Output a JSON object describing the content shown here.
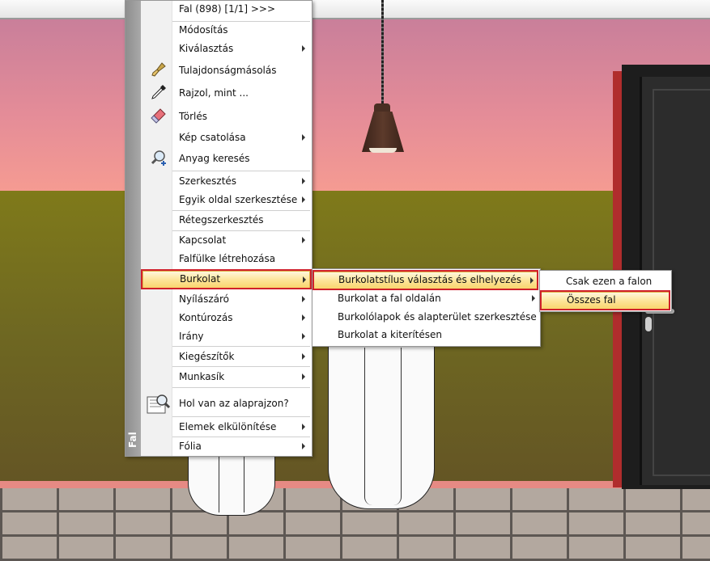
{
  "colors": {
    "highlight_fill": "#fde59a",
    "highlight_outline": "#d0202a",
    "sidebar": "#9a9a9a",
    "door_frame": "#b02d2d"
  },
  "menu": {
    "sidebar_title": "Fal",
    "items": [
      {
        "label": "Fal (898) [1/1] >>>",
        "icon": "",
        "submenu": false
      },
      {
        "label": "Módosítás",
        "icon": "",
        "submenu": false
      },
      {
        "label": "Kiválasztás",
        "icon": "",
        "submenu": true
      },
      {
        "label": "Tulajdonságmásolás",
        "icon": "paintbrush-icon",
        "submenu": false
      },
      {
        "label": "Rajzol, mint ...",
        "icon": "eyedropper-icon",
        "submenu": false
      },
      {
        "label": "Törlés",
        "icon": "eraser-icon",
        "submenu": false
      },
      {
        "label": "Kép csatolása",
        "icon": "",
        "submenu": true
      },
      {
        "label": "Anyag keresés",
        "icon": "magnifier-plus-icon",
        "submenu": false
      },
      {
        "label": "Szerkesztés",
        "icon": "",
        "submenu": true
      },
      {
        "label": "Egyik oldal szerkesztése",
        "icon": "",
        "submenu": true
      },
      {
        "label": "Rétegszerkesztés",
        "icon": "",
        "submenu": false
      },
      {
        "label": "Kapcsolat",
        "icon": "",
        "submenu": true
      },
      {
        "label": "Falfülke létrehozása",
        "icon": "",
        "submenu": false
      },
      {
        "label": "Burkolat",
        "icon": "",
        "submenu": true
      },
      {
        "label": "Nyílászáró",
        "icon": "",
        "submenu": true
      },
      {
        "label": "Kontúrozás",
        "icon": "",
        "submenu": true
      },
      {
        "label": "Irány",
        "icon": "",
        "submenu": true
      },
      {
        "label": "Kiegészítők",
        "icon": "",
        "submenu": true
      },
      {
        "label": "Munkasík",
        "icon": "",
        "submenu": true
      },
      {
        "label": "Hol van az alaprajzon?",
        "icon": "floorplan-search-icon",
        "submenu": false
      },
      {
        "label": "Elemek elkülönítése",
        "icon": "",
        "submenu": true
      },
      {
        "label": "Fólia",
        "icon": "",
        "submenu": true
      }
    ]
  },
  "submenu_burkolat": {
    "items": [
      {
        "label": "Burkolatstílus választás és elhelyezés",
        "submenu": true
      },
      {
        "label": "Burkolat a fal oldalán",
        "submenu": true
      },
      {
        "label": "Burkolólapok és alapterület szerkesztése",
        "submenu": false
      },
      {
        "label": "Burkolat a kiterítésen",
        "submenu": false
      }
    ]
  },
  "submenu_burkolatstilus": {
    "items": [
      {
        "label": "Csak ezen a falon"
      },
      {
        "label": "Összes fal"
      }
    ]
  }
}
